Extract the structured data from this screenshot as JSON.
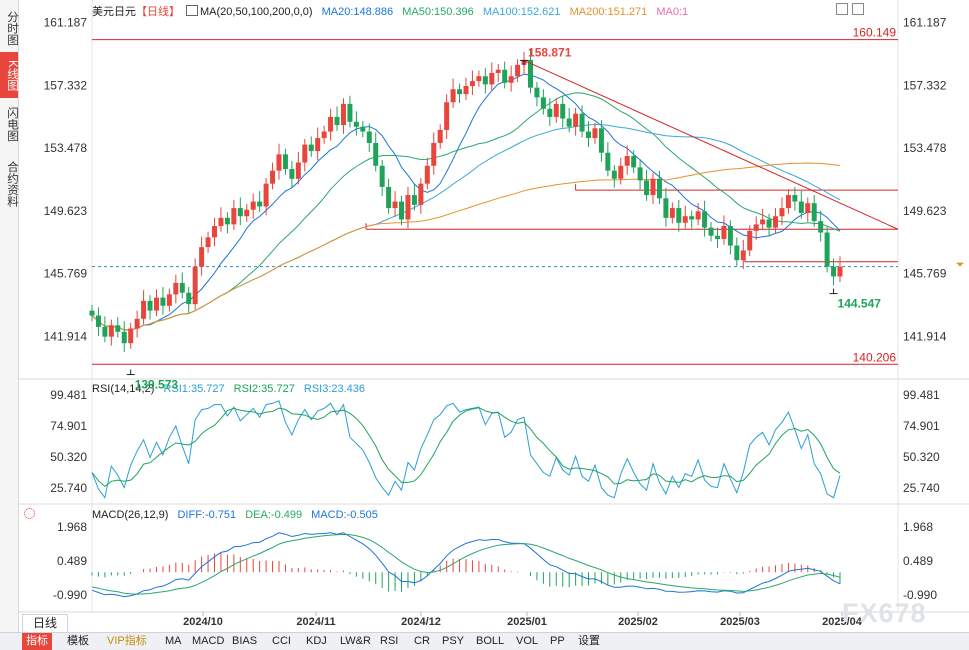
{
  "sidebar": {
    "tabs": [
      {
        "label": "分时图",
        "active": false
      },
      {
        "label": "K线图",
        "active": true
      },
      {
        "label": "闪电图",
        "active": false
      },
      {
        "label": "合约资料",
        "active": false
      }
    ]
  },
  "main_legend": {
    "symbol": "美元日元",
    "period": "【日线】",
    "ma_params": "MA(20,50,100,200,0,0)",
    "ma20": "MA20:148.886",
    "ma50": "MA50:150.396",
    "ma100": "MA100:152.621",
    "ma200": "MA200:151.271",
    "ma0": "MA0:1"
  },
  "rsi_legend": {
    "params": "RSI(14,14,2)",
    "rsi1": "RSI1:35.727",
    "rsi2": "RSI2:35.727",
    "rsi3": "RSI3:23.436"
  },
  "macd_legend": {
    "params": "MACD(26,12,9)",
    "diff": "DIFF:-0.751",
    "dea": "DEA:-0.499",
    "macd": "MACD:-0.505"
  },
  "colors": {
    "up": "#e8453c",
    "down": "#1fa35a",
    "ma20": "#1c75d8",
    "ma50": "#2aa86a",
    "ma100": "#3aa8d8",
    "ma200": "#e8912a",
    "support": "#d42424",
    "trend": "#d42424",
    "rsi": "#2a9fd6",
    "rsi2": "#1fa35a",
    "macd_diff": "#1c75d8",
    "macd_dea": "#2aa86a"
  },
  "chart_data": [
    {
      "type": "candlestick",
      "name": "price",
      "yticks": [
        "161.187",
        "157.332",
        "153.478",
        "149.623",
        "145.769",
        "141.914"
      ],
      "ylim": [
        139.3,
        161.6
      ],
      "x_dates": [
        "2024/10",
        "2024/11",
        "2024/12",
        "2025/01",
        "2025/02",
        "2025/03",
        "2025/04"
      ],
      "horizontal_levels": [
        {
          "label": "160.149",
          "value": 160.149
        },
        {
          "label": "140.206",
          "value": 140.206
        }
      ],
      "support_lines": [
        {
          "value": 148.5,
          "from": 0.34
        },
        {
          "value": 150.9,
          "from": 0.6
        },
        {
          "value": 146.5,
          "from": 0.81
        }
      ],
      "annotations": [
        {
          "text": "158.871",
          "value": 158.871,
          "kind": "high"
        },
        {
          "text": "139.573",
          "value": 139.573,
          "kind": "low"
        },
        {
          "text": "144.547",
          "value": 144.547,
          "kind": "low"
        }
      ],
      "current_price": 146.2,
      "trendline": {
        "from": 158.87,
        "to": 148.5
      },
      "closes": [
        143.2,
        142.5,
        141.9,
        142.6,
        142.2,
        141.5,
        142.4,
        143.0,
        144.1,
        143.5,
        144.3,
        143.8,
        144.5,
        145.2,
        144.6,
        143.9,
        146.2,
        147.4,
        148.0,
        148.7,
        149.2,
        148.8,
        149.8,
        149.3,
        149.7,
        150.2,
        149.9,
        151.3,
        152.1,
        153.1,
        152.2,
        151.6,
        152.6,
        153.7,
        153.3,
        154.1,
        154.5,
        155.4,
        154.9,
        156.2,
        155.1,
        154.8,
        154.5,
        153.8,
        152.4,
        151.1,
        149.8,
        150.2,
        149.1,
        150.6,
        150.0,
        151.3,
        152.4,
        153.8,
        154.6,
        156.3,
        157.1,
        156.8,
        157.3,
        157.6,
        157.9,
        157.4,
        158.1,
        158.3,
        157.5,
        157.9,
        158.6,
        158.9,
        157.2,
        156.6,
        155.9,
        155.4,
        156.2,
        155.3,
        154.8,
        155.6,
        154.5,
        154.1,
        154.7,
        153.2,
        152.1,
        151.6,
        152.4,
        153.0,
        152.3,
        151.5,
        150.6,
        151.6,
        150.4,
        149.2,
        149.8,
        148.9,
        149.3,
        149.1,
        149.6,
        148.6,
        148.1,
        147.9,
        148.7,
        147.5,
        146.6,
        147.2,
        148.4,
        148.8,
        149.1,
        148.6,
        149.3,
        149.8,
        150.6,
        150.2,
        149.5,
        150.1,
        149.0,
        148.3,
        146.2,
        145.6,
        146.2
      ]
    },
    {
      "type": "line",
      "name": "rsi",
      "yticks": [
        "99.481",
        "74.901",
        "50.320",
        "25.740"
      ],
      "ylim": [
        13,
        102
      ],
      "values": [
        38,
        25,
        18,
        43,
        36,
        26,
        44,
        55,
        64,
        50,
        62,
        52,
        66,
        75,
        59,
        45,
        80,
        88,
        89,
        92,
        92,
        83,
        90,
        79,
        84,
        89,
        82,
        92,
        93,
        95,
        78,
        68,
        80,
        88,
        80,
        87,
        89,
        93,
        84,
        92,
        66,
        61,
        56,
        46,
        34,
        26,
        20,
        31,
        24,
        46,
        40,
        57,
        68,
        80,
        84,
        91,
        93,
        86,
        88,
        89,
        90,
        76,
        85,
        86,
        66,
        70,
        80,
        82,
        52,
        45,
        38,
        35,
        50,
        40,
        36,
        51,
        35,
        31,
        44,
        26,
        20,
        18,
        37,
        49,
        38,
        29,
        24,
        45,
        30,
        21,
        35,
        26,
        37,
        35,
        48,
        32,
        27,
        26,
        45,
        33,
        22,
        38,
        60,
        66,
        70,
        60,
        72,
        78,
        86,
        72,
        57,
        68,
        45,
        37,
        21,
        18,
        35.7
      ]
    },
    {
      "type": "bar+line",
      "name": "macd",
      "yticks": [
        "1.968",
        "0.489",
        "-0.990"
      ],
      "ylim": [
        -1.55,
        2.35
      ],
      "diff": [
        -0.78,
        -0.88,
        -0.98,
        -0.95,
        -0.99,
        -1.06,
        -1.02,
        -0.94,
        -0.8,
        -0.76,
        -0.65,
        -0.6,
        -0.48,
        -0.32,
        -0.28,
        -0.34,
        -0.05,
        0.24,
        0.45,
        0.67,
        0.86,
        0.92,
        1.1,
        1.12,
        1.19,
        1.28,
        1.3,
        1.45,
        1.56,
        1.71,
        1.65,
        1.55,
        1.6,
        1.68,
        1.64,
        1.67,
        1.68,
        1.71,
        1.65,
        1.71,
        1.55,
        1.39,
        1.23,
        1.02,
        0.74,
        0.39,
        0.02,
        -0.15,
        -0.4,
        -0.4,
        -0.46,
        -0.36,
        -0.16,
        0.12,
        0.38,
        0.71,
        0.96,
        1.11,
        1.25,
        1.33,
        1.41,
        1.38,
        1.42,
        1.42,
        1.32,
        1.26,
        1.26,
        1.24,
        1.04,
        0.8,
        0.55,
        0.32,
        0.24,
        0.09,
        -0.05,
        -0.07,
        -0.19,
        -0.29,
        -0.29,
        -0.41,
        -0.56,
        -0.65,
        -0.65,
        -0.6,
        -0.6,
        -0.65,
        -0.72,
        -0.7,
        -0.74,
        -0.82,
        -0.83,
        -0.87,
        -0.86,
        -0.84,
        -0.8,
        -0.81,
        -0.85,
        -0.86,
        -0.8,
        -0.82,
        -0.9,
        -0.89,
        -0.75,
        -0.61,
        -0.47,
        -0.4,
        -0.27,
        -0.13,
        0.04,
        0.1,
        0.13,
        0.17,
        0.1,
        0.04,
        -0.17,
        -0.37,
        -0.5
      ],
      "dea": [
        -0.64,
        -0.69,
        -0.76,
        -0.81,
        -0.85,
        -0.91,
        -0.94,
        -0.95,
        -0.94,
        -0.92,
        -0.88,
        -0.85,
        -0.8,
        -0.74,
        -0.69,
        -0.66,
        -0.57,
        -0.44,
        -0.3,
        -0.15,
        0.03,
        0.16,
        0.33,
        0.46,
        0.58,
        0.7,
        0.81,
        0.94,
        1.07,
        1.22,
        1.31,
        1.36,
        1.41,
        1.47,
        1.51,
        1.55,
        1.58,
        1.61,
        1.62,
        1.64,
        1.63,
        1.58,
        1.51,
        1.41,
        1.26,
        1.07,
        0.86,
        0.66,
        0.45,
        0.28,
        0.13,
        0.03,
        -0.01,
        0.01,
        0.09,
        0.21,
        0.37,
        0.53,
        0.68,
        0.81,
        0.93,
        1.02,
        1.1,
        1.17,
        1.2,
        1.22,
        1.23,
        1.24,
        1.21,
        1.15,
        1.05,
        0.94,
        0.83,
        0.72,
        0.6,
        0.51,
        0.4,
        0.29,
        0.2,
        0.1,
        -0.02,
        -0.12,
        -0.21,
        -0.27,
        -0.32,
        -0.37,
        -0.42,
        -0.46,
        -0.5,
        -0.54,
        -0.58,
        -0.62,
        -0.65,
        -0.68,
        -0.7,
        -0.72,
        -0.75,
        -0.77,
        -0.78,
        -0.79,
        -0.81,
        -0.83,
        -0.81,
        -0.77,
        -0.71,
        -0.65,
        -0.57,
        -0.48,
        -0.37,
        -0.28,
        -0.2,
        -0.12,
        -0.08,
        -0.05,
        -0.08,
        -0.14,
        -0.22
      ],
      "hist": [
        -0.14,
        -0.19,
        -0.22,
        -0.14,
        -0.14,
        -0.15,
        -0.08,
        0.01,
        0.14,
        0.16,
        0.23,
        0.25,
        0.32,
        0.42,
        0.41,
        0.32,
        0.52,
        0.68,
        0.75,
        0.82,
        0.83,
        0.76,
        0.77,
        0.66,
        0.61,
        0.58,
        0.49,
        0.51,
        0.49,
        0.49,
        0.34,
        0.19,
        0.19,
        0.21,
        0.13,
        0.12,
        0.1,
        0.1,
        0.03,
        0.07,
        -0.08,
        -0.19,
        -0.28,
        -0.39,
        -0.52,
        -0.68,
        -0.84,
        -0.81,
        -0.85,
        -0.68,
        -0.59,
        -0.39,
        -0.15,
        0.11,
        0.29,
        0.5,
        0.59,
        0.58,
        0.57,
        0.52,
        0.48,
        0.36,
        0.32,
        0.25,
        0.12,
        0.04,
        0.03,
        0,
        -0.17,
        -0.35,
        -0.5,
        -0.62,
        -0.59,
        -0.63,
        -0.65,
        -0.58,
        -0.59,
        -0.58,
        -0.49,
        -0.51,
        -0.54,
        -0.53,
        -0.44,
        -0.33,
        -0.28,
        -0.28,
        -0.3,
        -0.24,
        -0.24,
        -0.28,
        -0.25,
        -0.25,
        -0.21,
        -0.16,
        -0.1,
        -0.09,
        -0.1,
        -0.09,
        -0.02,
        -0.03,
        -0.09,
        -0.06,
        0.06,
        0.16,
        0.24,
        0.25,
        0.3,
        0.35,
        0.41,
        0.38,
        0.33,
        0.29,
        0.18,
        0.09,
        -0.09,
        -0.23,
        -0.505
      ]
    }
  ],
  "bottom_bar": {
    "period": "日线",
    "items": [
      "指标",
      "模板",
      "VIP指标",
      "MA",
      "MACD",
      "BIAS",
      "CCI",
      "KDJ",
      "LW&R",
      "RSI",
      "CR",
      "PSY",
      "BOLL",
      "VOL",
      "PP",
      "设置"
    ]
  },
  "watermark": "FX678"
}
